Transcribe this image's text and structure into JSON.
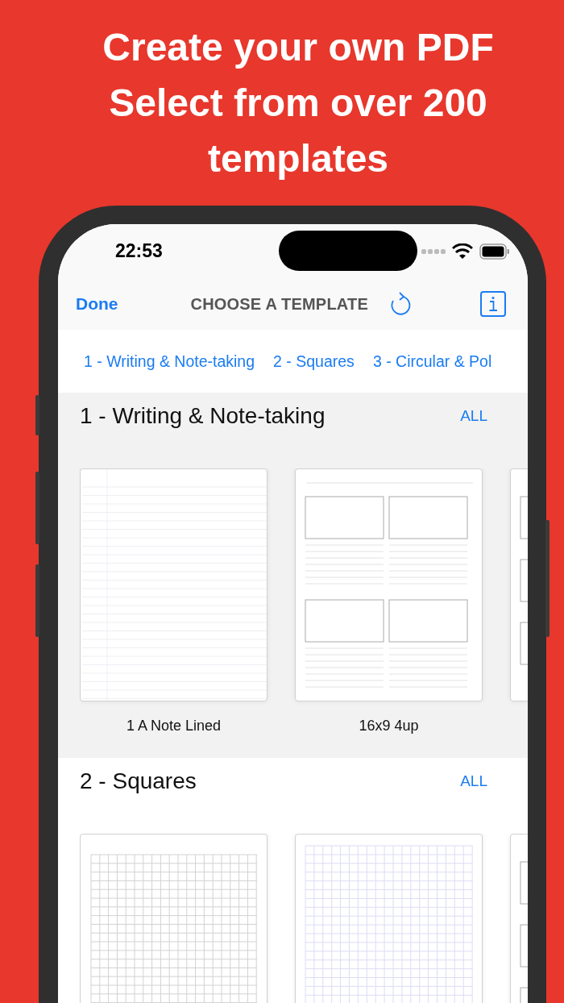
{
  "headline": [
    "Create your own PDF",
    "Select from over 200",
    "templates"
  ],
  "status_bar": {
    "time": "22:53"
  },
  "nav_bar": {
    "done": "Done",
    "title": "CHOOSE A TEMPLATE"
  },
  "categories": [
    "1 - Writing & Note-taking",
    "2 - Squares",
    "3 - Circular & Pol"
  ],
  "sections": [
    {
      "title": "1 - Writing & Note-taking",
      "all": "ALL",
      "templates": [
        {
          "kind": "lined",
          "name": "1 A Note Lined"
        },
        {
          "kind": "storyboard",
          "name": "16x9 4up"
        },
        {
          "kind": "sliver"
        }
      ]
    },
    {
      "title": "2 - Squares",
      "all": "ALL",
      "templates": [
        {
          "kind": "grid"
        },
        {
          "kind": "fine-grid"
        },
        {
          "kind": "sliver"
        }
      ]
    }
  ]
}
